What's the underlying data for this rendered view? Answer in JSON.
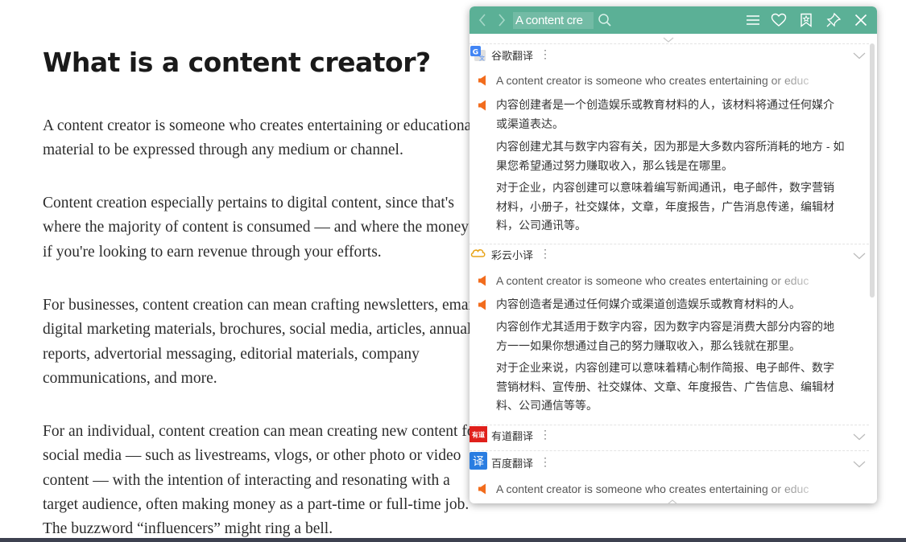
{
  "article": {
    "title": "What is a content creator?",
    "paragraphs": [
      [
        "A content creator is someone who creates entertaining or educational",
        "material to be expressed through any medium or channel."
      ],
      [
        "Content creation especially pertains to digital content, since that's",
        "where the majority of content is consumed — and where the money is",
        "if you're looking to earn revenue through your efforts."
      ],
      [
        "For businesses, content creation can mean crafting newsletters, emails,",
        "digital marketing materials, brochures, social media, articles, annual",
        "reports, advertorial messaging, editorial materials, company",
        "communications, and more."
      ],
      [
        "For an individual, content creation can mean creating new content for",
        "social media — such as livestreams, vlogs, or other photo or video",
        "content — with the intention of interacting and resonating with a",
        "target audience, often making money as a part-time or full-time job.",
        "The buzzword “influencers” might ring a bell."
      ]
    ]
  },
  "popup": {
    "search_value": "A content cre",
    "colors": {
      "header": "#5bb096",
      "speaker": "#f26c1d",
      "google_blue": "#4285f4",
      "youdao_red": "#e0201b",
      "baidu_blue": "#2a7de1",
      "caiyun_orange": "#e8a317"
    },
    "icons": [
      "back-arrow-icon",
      "forward-arrow-icon",
      "search-icon",
      "menu-icon",
      "favorite-heart-icon",
      "bookmark-icon",
      "pin-icon",
      "close-icon"
    ],
    "engines": [
      {
        "name": "谷歌翻译",
        "icon": "google-translate-icon",
        "source": "A content creator is someone who creates entertaining or educ",
        "lines": [
          [
            "内容创建者是一个创造娱乐或教育材料的人，该材料将通过任何媒介",
            "或渠道表达。"
          ],
          [
            "内容创建尤其与数字内容有关，因为那是大多数内容所消耗的地方 - 如",
            "果您希望通过努力赚取收入，那么钱是在哪里。"
          ],
          [
            "对于企业，内容创建可以意味着编写新闻通讯，电子邮件，数字营销",
            "材料，小册子，社交媒体，文章，年度报告，广告消息传递，编辑材",
            "料，公司通讯等。"
          ]
        ]
      },
      {
        "name": "彩云小译",
        "icon": "caiyun-cloud-icon",
        "source": "A content creator is someone who creates entertaining or educ",
        "lines": [
          [
            "内容创造者是通过任何媒介或渠道创造娱乐或教育材料的人。"
          ],
          [
            "内容创作尤其适用于数字内容，因为数字内容是消费大部分内容的地",
            "方一一如果你想通过自己的努力赚取收入，那么钱就在那里。"
          ],
          [
            "对于企业来说，内容创建可以意味着精心制作简报、电子邮件、数字",
            "营销材料、宣传册、社交媒体、文章、年度报告、广告信息、编辑材",
            "料、公司通信等等。"
          ]
        ]
      },
      {
        "name": "有道翻译",
        "icon": "youdao-icon",
        "badge": "有道"
      },
      {
        "name": "百度翻译",
        "icon": "baidu-translate-icon",
        "badge": "译",
        "source": "A content creator is someone who creates entertaining or educ"
      }
    ]
  }
}
